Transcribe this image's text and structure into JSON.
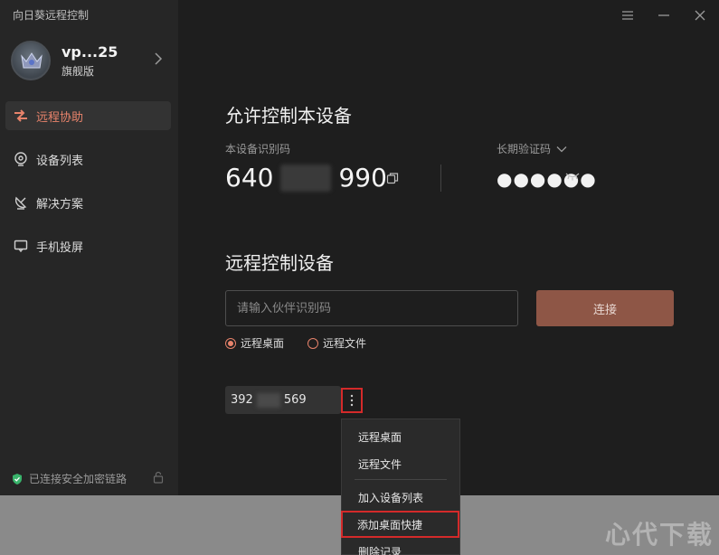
{
  "app": {
    "title": "向日葵远程控制"
  },
  "profile": {
    "name": "vp...25",
    "tier": "旗舰版"
  },
  "nav": [
    {
      "label": "远程协助",
      "icon": "remote-assist-icon",
      "active": true
    },
    {
      "label": "设备列表",
      "icon": "device-list-icon",
      "active": false
    },
    {
      "label": "解决方案",
      "icon": "satellite-dish-icon",
      "active": false
    },
    {
      "label": "手机投屏",
      "icon": "screen-cast-icon",
      "active": false
    }
  ],
  "status": {
    "secure_text": "已连接安全加密链路"
  },
  "allow": {
    "title": "允许控制本设备",
    "id_label": "本设备识别码",
    "id_prefix": "640",
    "id_suffix": "990",
    "code_label": "长期验证码",
    "code_value": "●●●●●●"
  },
  "control": {
    "title": "远程控制设备",
    "input_placeholder": "请输入伙伴识别码",
    "connect_label": "连接",
    "options": [
      {
        "label": "远程桌面",
        "selected": true
      },
      {
        "label": "远程文件",
        "selected": false
      }
    ],
    "history": {
      "prefix": "392",
      "suffix": "569"
    }
  },
  "menu": {
    "items": [
      "远程桌面",
      "远程文件",
      "加入设备列表",
      "添加桌面快捷",
      "删除记录"
    ],
    "highlighted": "添加桌面快捷"
  },
  "colors": {
    "accent": "#e8836b",
    "connect": "#8e5646",
    "highlight_border": "#d42a2a"
  },
  "watermark": "心代下载"
}
